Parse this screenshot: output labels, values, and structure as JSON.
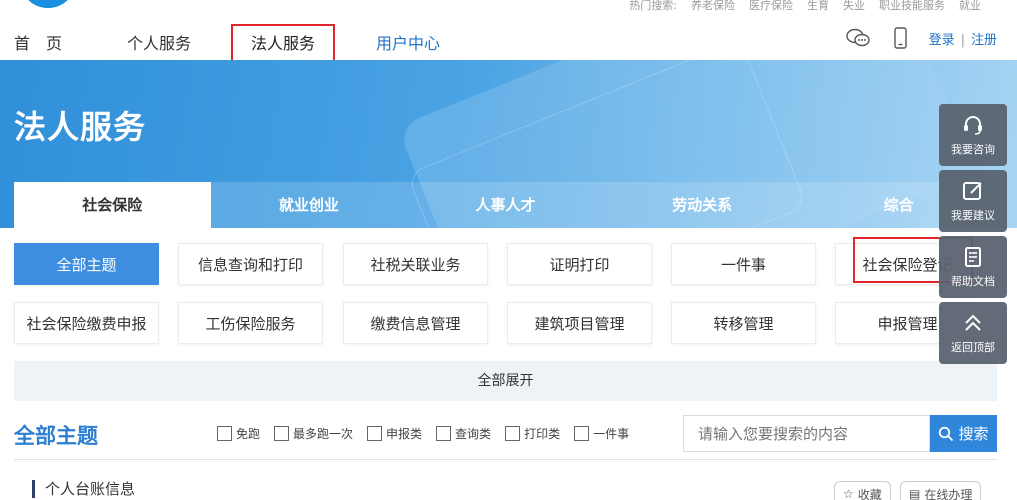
{
  "top": {
    "hot_search": [
      "热门搜索:",
      "养老保险",
      "医疗保险",
      "生育",
      "失业",
      "职业技能服务",
      "就业"
    ]
  },
  "nav": {
    "items": [
      "首　页",
      "个人服务",
      "法人服务",
      "用户中心"
    ],
    "login": "登录",
    "register": "注册",
    "separator": "|"
  },
  "icons": {
    "chat": "chat-bubbles-icon",
    "mobile": "mobile-phone-icon"
  },
  "banner": {
    "title": "法人服务"
  },
  "category_tabs": [
    "社会保险",
    "就业创业",
    "人事人才",
    "劳动关系",
    "综合"
  ],
  "grid": {
    "row1": [
      "全部主题",
      "信息查询和打印",
      "社税关联业务",
      "证明打印",
      "一件事",
      "社会保险登记"
    ],
    "row2": [
      "社会保险缴费申报",
      "工伤保险服务",
      "缴费信息管理",
      "建筑项目管理",
      "转移管理",
      "申报管理"
    ]
  },
  "expand_all": "全部展开",
  "section": {
    "title": "全部主题",
    "filters": [
      "免跑",
      "最多跑一次",
      "申报类",
      "查询类",
      "打印类",
      "一件事"
    ]
  },
  "search": {
    "placeholder": "请输入您要搜索的内容",
    "button": "搜索"
  },
  "list": {
    "subtitle": "个人台账信息",
    "collect": "收藏",
    "online": "在线办理"
  },
  "side_panel": [
    "我要咨询",
    "我要建议",
    "帮助文档",
    "返回顶部"
  ],
  "colors": {
    "accent": "#2f86db",
    "highlight_box": "#e0262b",
    "side_panel": "#5a6470"
  }
}
